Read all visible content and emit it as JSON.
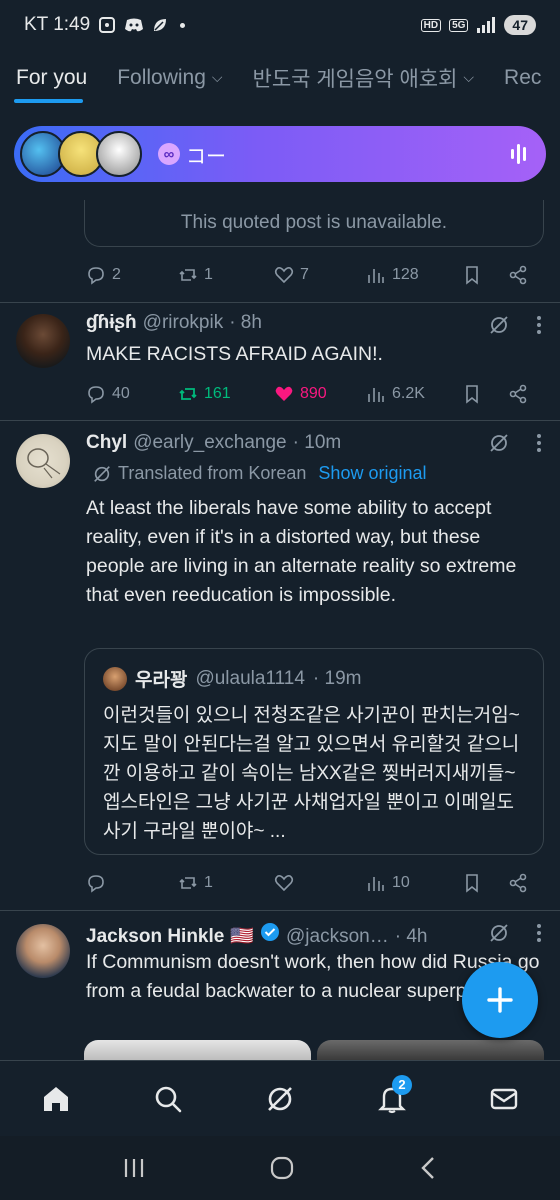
{
  "status_bar": {
    "carrier_time": "KT 1:49",
    "hd": "HD",
    "network": "5G",
    "battery": "47"
  },
  "tabs": [
    {
      "label": "For you",
      "active": true
    },
    {
      "label": "Following",
      "has_chevron": true
    },
    {
      "label": "반도국 게임음악 애호회",
      "has_chevron": true
    },
    {
      "label": "Rec"
    }
  ],
  "space": {
    "title": "コー",
    "infinity": "∞"
  },
  "post0": {
    "quoted_unavailable": "This quoted post is unavailable.",
    "replies": "2",
    "reposts": "1",
    "likes": "7",
    "views": "128"
  },
  "post1": {
    "name": "ɠɦɨʂɦ",
    "handle": "@rirokpik",
    "time": "· 8h",
    "text": "MAKE RACISTS AFRAID AGAIN!.",
    "replies": "40",
    "reposts": "161",
    "likes": "890",
    "views": "6.2K",
    "repost_color": "#00ba7c",
    "like_color": "#f91880"
  },
  "post2": {
    "name": "Chyl",
    "handle": "@early_exchange",
    "time": "· 10m",
    "translated_label": "Translated from Korean",
    "show_original": "Show original",
    "text": "At least the liberals have some ability to accept reality, even if it's in a distorted way, but these people are living in an alternate reality so extreme that even reeducation is impossible.",
    "quote": {
      "name": "우라꽝",
      "handle": "@ulaula1114",
      "time": "· 19m",
      "text": "이런것들이 있으니 전청조같은 사기꾼이 판치는거임~ 지도 말이 안된다는걸 알고 있으면서 유리할것 같으니깐 이용하고 같이 속이는 남XX같은 찢버러지새끼들~ 엡스타인은 그냥 사기꾼 사채업자일 뿐이고 이메일도 사기 구라일 뿐이야~ ..."
    },
    "replies": "",
    "reposts": "1",
    "likes": "",
    "views": "10"
  },
  "post3": {
    "name": "Jackson Hinkle",
    "flag": "🇺🇸",
    "handle": "@jackson…",
    "time": "· 4h",
    "text": "If Communism doesn't work, then how did Russia go from a feudal backwater to a nuclear superpower?\""
  },
  "bottom_nav": {
    "notifications_count": "2"
  },
  "colors": {
    "background": "#15202b",
    "accent": "#1d9bf0",
    "border": "#38444d",
    "muted": "#8b98a5"
  }
}
